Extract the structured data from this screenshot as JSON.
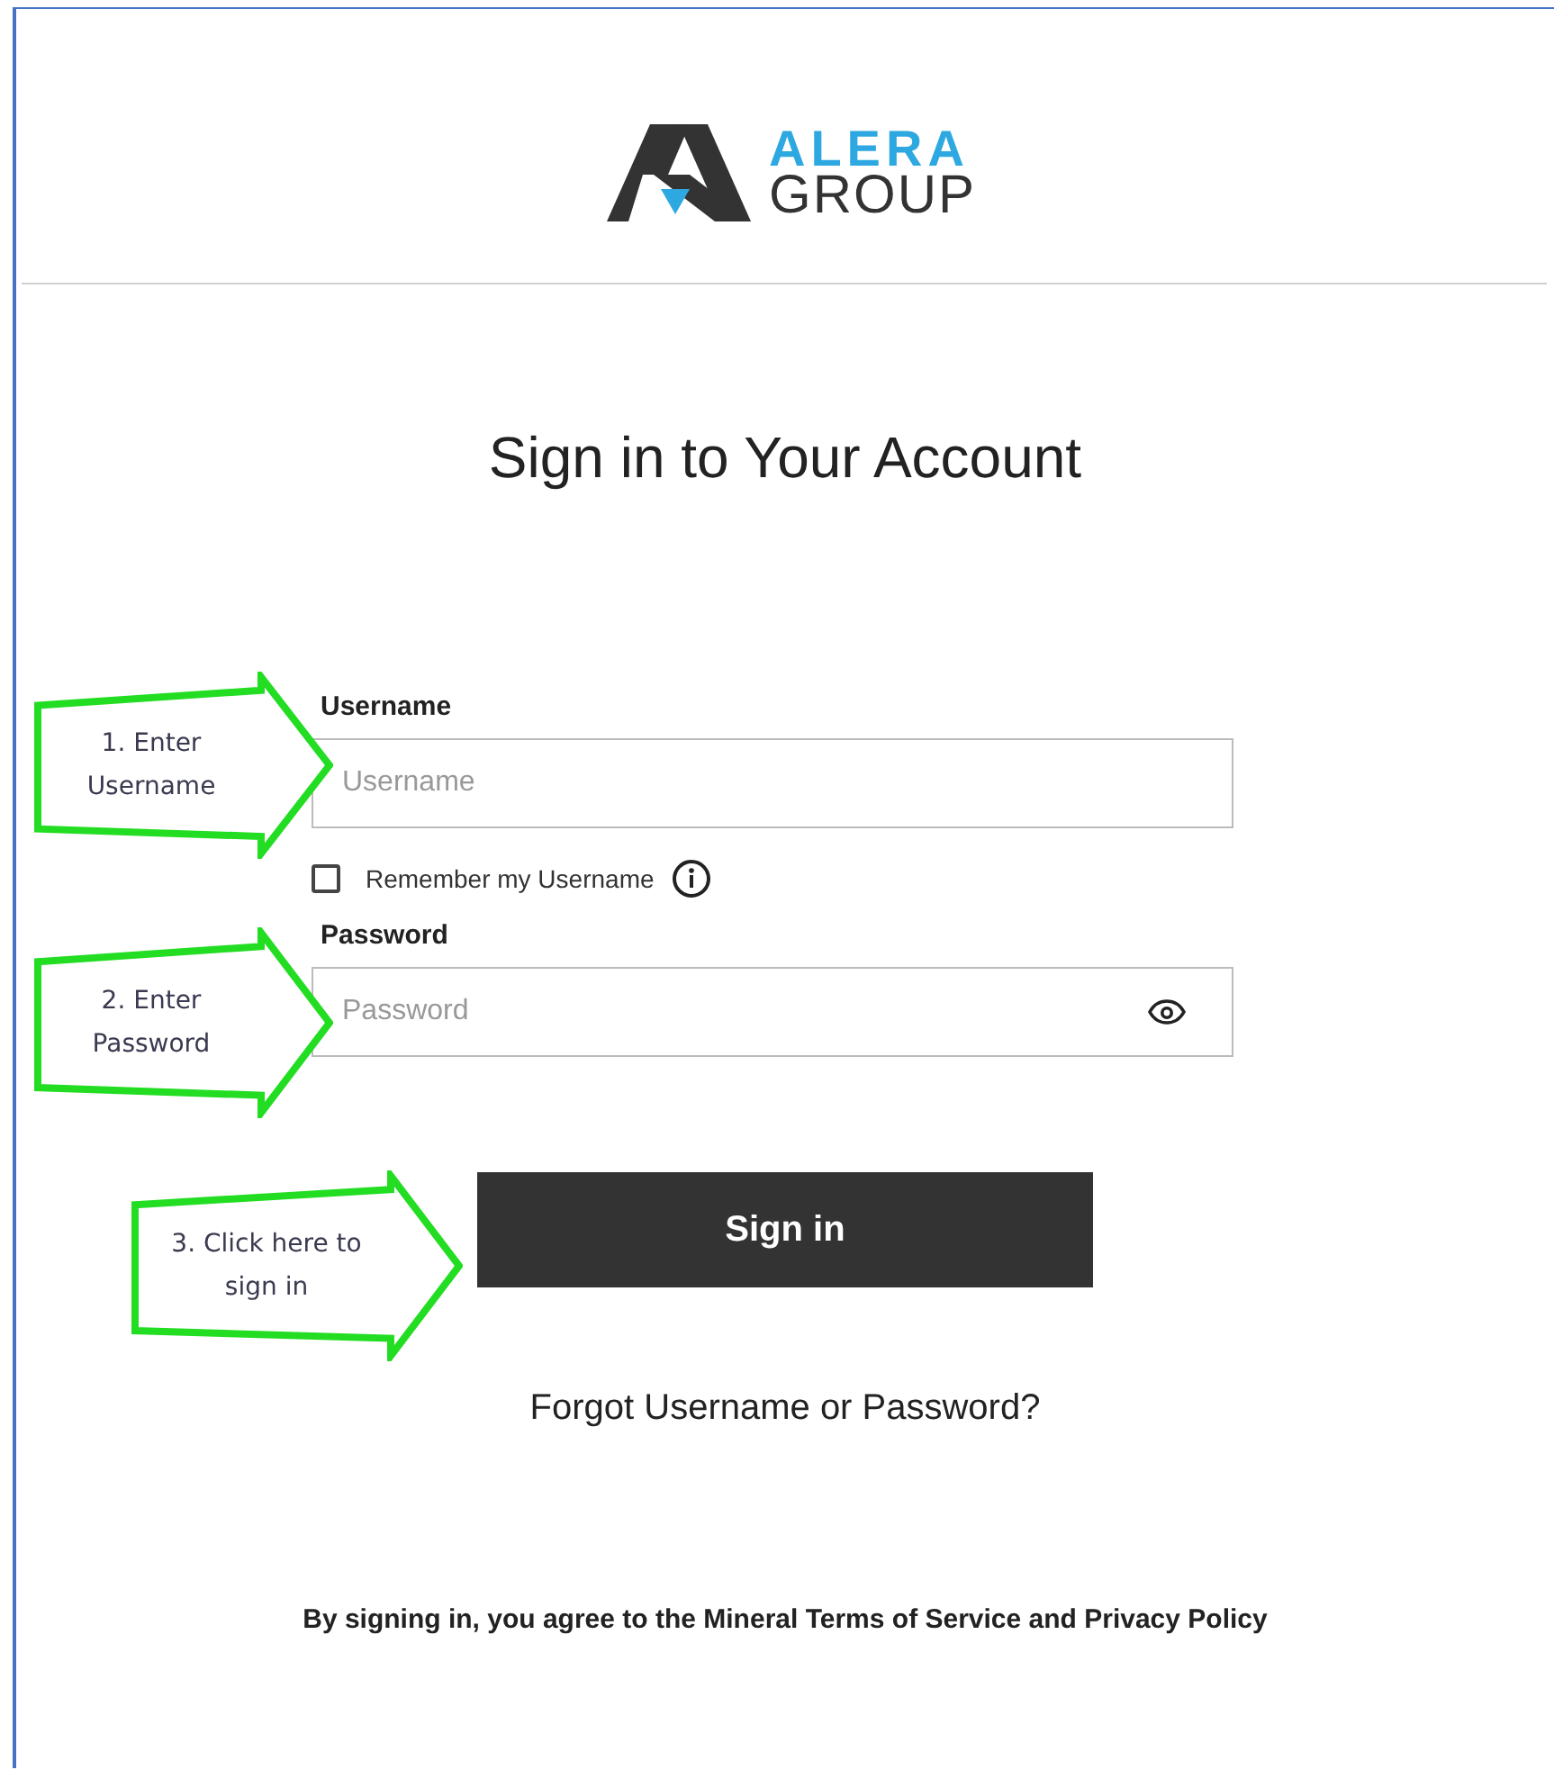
{
  "logo": {
    "line_1": "ALERA",
    "line_2": "GROUP"
  },
  "title": "Sign in to Your Account",
  "username": {
    "label": "Username",
    "placeholder": "Username"
  },
  "remember": {
    "label": "Remember my Username",
    "checked": false
  },
  "password": {
    "label": "Password",
    "placeholder": "Password"
  },
  "sign_in_button": "Sign in",
  "forgot_link": "Forgot Username or Password?",
  "footer": "By signing in, you agree to the Mineral Terms of Service and Privacy Policy",
  "callouts": [
    {
      "text": "1. Enter Username"
    },
    {
      "text": "2. Enter Password"
    },
    {
      "text": "3. Click here to sign in"
    }
  ]
}
